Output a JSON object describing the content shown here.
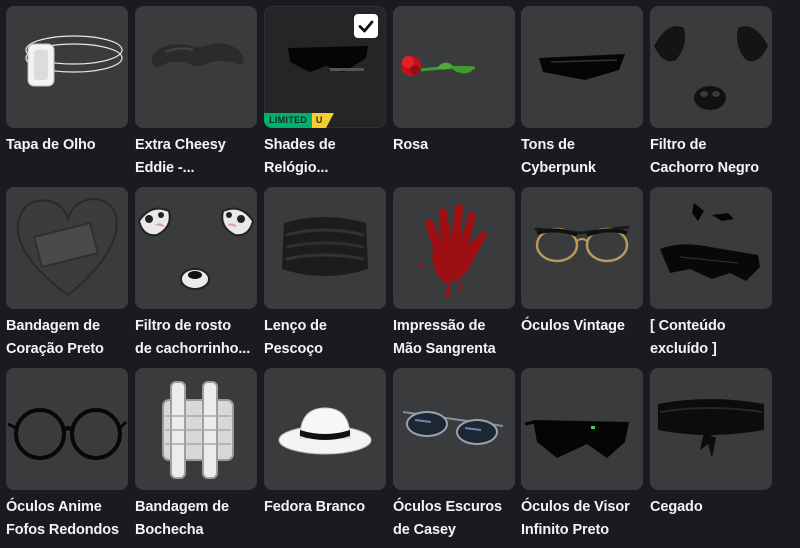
{
  "items": [
    {
      "name": "Tapa de Olho",
      "icon": "eyepatch-icon",
      "selected": false,
      "limited": false
    },
    {
      "name": "Extra Cheesy\nEddie -...",
      "icon": "mustache-icon",
      "selected": false,
      "limited": false
    },
    {
      "name": "Shades de\nRelógio...",
      "icon": "shades-icon",
      "selected": true,
      "limited": true
    },
    {
      "name": "Rosa",
      "icon": "rose-icon",
      "selected": false,
      "limited": false
    },
    {
      "name": "Tons de\nCyberpunk",
      "icon": "cyberpunk-glasses-icon",
      "selected": false,
      "limited": false
    },
    {
      "name": "Filtro de\nCachorro Negro",
      "icon": "black-dog-filter-icon",
      "selected": false,
      "limited": false
    },
    {
      "name": "Bandagem de\nCoração Preto",
      "icon": "heart-bandage-icon",
      "selected": false,
      "limited": false
    },
    {
      "name": "Filtro de rosto\nde cachorrinho...",
      "icon": "puppy-filter-icon",
      "selected": false,
      "limited": false
    },
    {
      "name": "Lenço de\nPescoço",
      "icon": "neck-scarf-icon",
      "selected": false,
      "limited": false
    },
    {
      "name": "Impressão de\nMão Sangrenta",
      "icon": "bloody-hand-icon",
      "selected": false,
      "limited": false
    },
    {
      "name": "Óculos Vintage",
      "icon": "vintage-glasses-icon",
      "selected": false,
      "limited": false
    },
    {
      "name": "[ Conteúdo\nexcluído ]",
      "icon": "deleted-content-icon",
      "selected": false,
      "limited": false
    },
    {
      "name": "Óculos Anime\nFofos Redondos",
      "icon": "round-glasses-icon",
      "selected": false,
      "limited": false
    },
    {
      "name": "Bandagem de\nBochecha",
      "icon": "cheek-bandage-icon",
      "selected": false,
      "limited": false
    },
    {
      "name": "Fedora Branco",
      "icon": "white-fedora-icon",
      "selected": false,
      "limited": false
    },
    {
      "name": "Óculos Escuros\nde Casey",
      "icon": "casey-sunglasses-icon",
      "selected": false,
      "limited": false
    },
    {
      "name": "Óculos de Visor\nInfinito Preto",
      "icon": "visor-glasses-icon",
      "selected": false,
      "limited": false
    },
    {
      "name": "Cegado",
      "icon": "blindfold-icon",
      "selected": false,
      "limited": false
    }
  ],
  "badges": {
    "limited_label": "LIMITED",
    "unique_label": "U",
    "limited_color": "#00b06f",
    "unique_color": "#f5cd30"
  },
  "colors": {
    "background": "#191b1f",
    "tile": "#393b3d",
    "selected_tile": "#232527",
    "text": "#f2f4f5"
  }
}
